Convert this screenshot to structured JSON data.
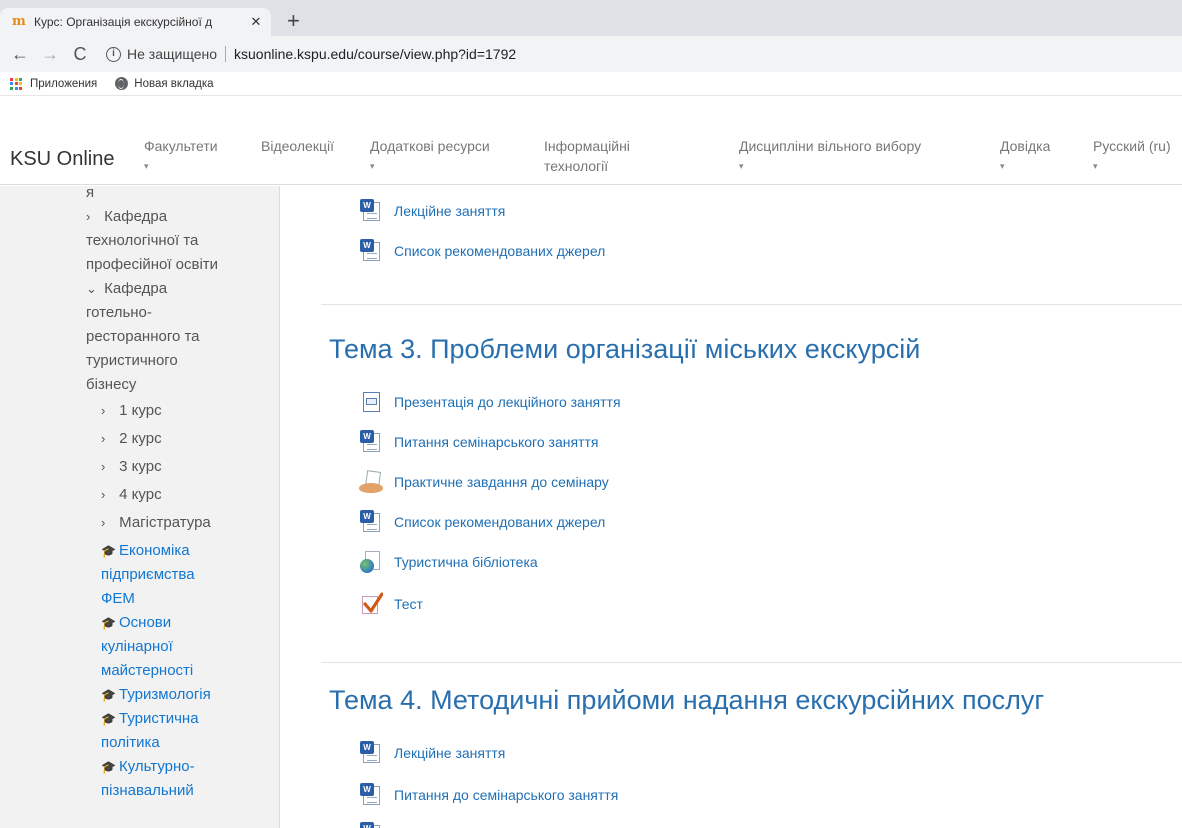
{
  "browser": {
    "tab_title": "Курс: Організація екскурсійної д",
    "tab_close": "✕",
    "new_tab": "+",
    "back": "←",
    "forward": "→",
    "reload": "C",
    "security_label": "Не защищено",
    "url": "ksuonline.kspu.edu/course/view.php?id=1792",
    "bookmarks": [
      "Приложения",
      "Новая вкладка"
    ]
  },
  "navbar": {
    "brand": "KSU Online",
    "menu": [
      {
        "label": "Факультети",
        "caret": "▾"
      },
      {
        "label": "Відеолекції",
        "caret": ""
      },
      {
        "label": "Додаткові ресурси",
        "caret": "▾"
      },
      {
        "label": "Інформаційні",
        "label2": "технології",
        "caret": ""
      },
      {
        "label": "Дисципліни вільного вибору",
        "caret": "▾"
      },
      {
        "label": "Довідка",
        "caret": "▾"
      },
      {
        "label": "Русский (ru)",
        "caret": "▾"
      }
    ]
  },
  "sidebar": {
    "items": [
      {
        "text": "я"
      },
      {
        "text": "Кафедра",
        "chev": "›"
      },
      {
        "text": "технологічної та"
      },
      {
        "text": "професійної освіти"
      },
      {
        "text": "Кафедра",
        "chev": "⌄"
      },
      {
        "text": "готельно-"
      },
      {
        "text": "ресторанного та"
      },
      {
        "text": "туристичного"
      },
      {
        "text": "бізнесу"
      },
      {
        "text": "1 курс",
        "chev": "›"
      },
      {
        "text": "2 курс",
        "chev": "›"
      },
      {
        "text": "3 курс",
        "chev": "›"
      },
      {
        "text": "4 курс",
        "chev": "›"
      },
      {
        "text": "Магістратура",
        "chev": "›"
      },
      {
        "text": "Економіка"
      },
      {
        "text": "підприємства"
      },
      {
        "text": "ФЕМ"
      },
      {
        "text": "Основи"
      },
      {
        "text": "кулінарної"
      },
      {
        "text": "майстерності"
      },
      {
        "text": "Туризмологія"
      },
      {
        "text": "Туристична"
      },
      {
        "text": "політика"
      },
      {
        "text": "Культурно-"
      },
      {
        "text": "пізнавальний"
      }
    ]
  },
  "content": {
    "top_activities": [
      {
        "label": "Лекційне заняття",
        "icon": "word-icon"
      },
      {
        "label": "Список рекомендованих джерел",
        "icon": "word-icon"
      }
    ],
    "sections": [
      {
        "title": "Тема 3. Проблеми організації міських екскурсій",
        "activities": [
          {
            "label": "Презентація до лекційного заняття",
            "icon": "presentation-icon"
          },
          {
            "label": "Питання семінарського заняття",
            "icon": "word-icon"
          },
          {
            "label": "Практичне завдання до семінару",
            "icon": "assignment-icon"
          },
          {
            "label": "Список рекомендованих джерел",
            "icon": "word-icon"
          },
          {
            "label": "Туристична бібліотека",
            "icon": "url-icon"
          },
          {
            "label": "Тест",
            "icon": "quiz-icon"
          }
        ]
      },
      {
        "title": "Тема 4. Методичні прийоми надання екскурсійних послуг",
        "activities": [
          {
            "label": "Лекційне заняття",
            "icon": "word-icon"
          },
          {
            "label": "Питання до семінарського заняття",
            "icon": "word-icon"
          }
        ]
      }
    ]
  },
  "colors": {
    "link": "#1f6fb5",
    "section_title": "#2a6fad",
    "sidebar_bg": "#f2f2f2",
    "sidebar_link": "#1177d1"
  }
}
